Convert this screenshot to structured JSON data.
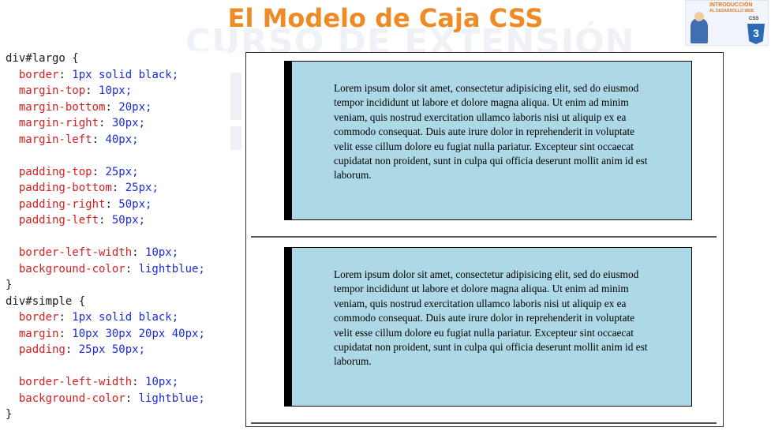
{
  "title": "El Modelo de Caja CSS",
  "watermark": "CURSO DE EXTENSIÓN",
  "logo": {
    "line1": "INTRODUCCIÓN",
    "line2": "AL DESARROLLO WEB",
    "css_label": "CSS",
    "shield_symbol": "3"
  },
  "code_lines": [
    {
      "sel": "div#largo {"
    },
    {
      "prop": "border",
      "val": "1px solid black;"
    },
    {
      "prop": "margin-top",
      "val": "10px;"
    },
    {
      "prop": "margin-bottom",
      "val": "20px;"
    },
    {
      "prop": "margin-right",
      "val": "30px;"
    },
    {
      "prop": "margin-left",
      "val": "40px;"
    },
    {
      "gap": true
    },
    {
      "prop": "padding-top",
      "val": "25px;"
    },
    {
      "prop": "padding-bottom",
      "val": "25px;"
    },
    {
      "prop": "padding-right",
      "val": "50px;"
    },
    {
      "prop": "padding-left",
      "val": "50px;"
    },
    {
      "gap": true
    },
    {
      "prop": "border-left-width",
      "val": "10px;"
    },
    {
      "prop": "background-color",
      "val": "lightblue;"
    },
    {
      "sel": "}"
    },
    {
      "sel": "div#simple {"
    },
    {
      "prop": "border",
      "val": "1px solid black;"
    },
    {
      "prop": "margin",
      "val": "10px 30px 20px 40px;"
    },
    {
      "prop": "padding",
      "val": "25px 50px;"
    },
    {
      "gap": true
    },
    {
      "prop": "border-left-width",
      "val": "10px;"
    },
    {
      "prop": "background-color",
      "val": "lightblue;"
    },
    {
      "sel": "}"
    }
  ],
  "preview": {
    "lorem": "Lorem ipsum dolor sit amet, consectetur adipisicing elit, sed do eiusmod tempor incididunt ut labore et dolore magna aliqua. Ut enim ad minim veniam, quis nostrud exercitation ullamco laboris nisi ut aliquip ex ea commodo consequat. Duis aute irure dolor in reprehenderit in voluptate velit esse cillum dolore eu fugiat nulla pariatur. Excepteur sint occaecat cupidatat non proident, sunt in culpa qui officia deserunt mollit anim id est laborum."
  },
  "colors": {
    "title": "#f08a24",
    "property": "#d32020",
    "value": "#1c2bd6",
    "box_background": "#add8e6"
  }
}
